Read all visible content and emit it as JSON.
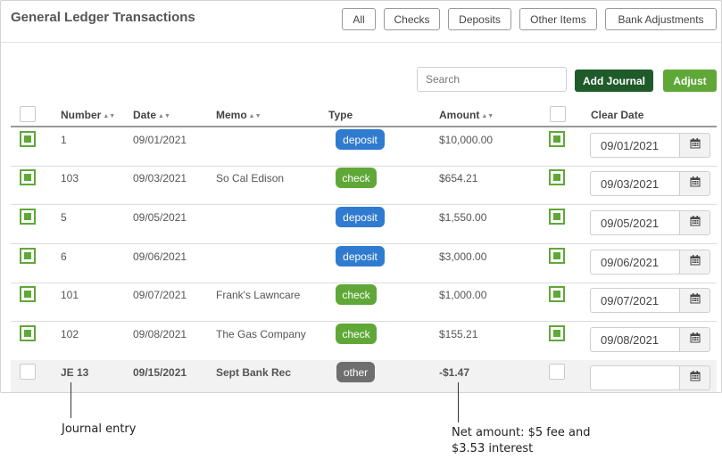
{
  "header": {
    "title": "General Ledger Transactions",
    "filters": [
      "All",
      "Checks",
      "Deposits",
      "Other Items",
      "Bank Adjustments"
    ]
  },
  "toolbar": {
    "search_placeholder": "Search",
    "add_journal_label": "Add Journal",
    "adjust_label": "Adjust"
  },
  "table": {
    "headers": {
      "number": "Number",
      "date": "Date",
      "memo": "Memo",
      "type": "Type",
      "amount": "Amount",
      "clear_date": "Clear Date"
    },
    "rows": [
      {
        "number": "1",
        "date": "09/01/2021",
        "memo": "",
        "type": "deposit",
        "amount": "$10,000.00",
        "clear_date": "09/01/2021",
        "selected": true,
        "cleared": true
      },
      {
        "number": "103",
        "date": "09/03/2021",
        "memo": "So Cal Edison",
        "type": "check",
        "amount": "$654.21",
        "clear_date": "09/03/2021",
        "selected": true,
        "cleared": true
      },
      {
        "number": "5",
        "date": "09/05/2021",
        "memo": "",
        "type": "deposit",
        "amount": "$1,550.00",
        "clear_date": "09/05/2021",
        "selected": true,
        "cleared": true
      },
      {
        "number": "6",
        "date": "09/06/2021",
        "memo": "",
        "type": "deposit",
        "amount": "$3,000.00",
        "clear_date": "09/06/2021",
        "selected": true,
        "cleared": true
      },
      {
        "number": "101",
        "date": "09/07/2021",
        "memo": "Frank's Lawncare",
        "type": "check",
        "amount": "$1,000.00",
        "clear_date": "09/07/2021",
        "selected": true,
        "cleared": true
      },
      {
        "number": "102",
        "date": "09/08/2021",
        "memo": "The Gas Company",
        "type": "check",
        "amount": "$155.21",
        "clear_date": "09/08/2021",
        "selected": true,
        "cleared": true
      },
      {
        "number": "JE 13",
        "date": "09/15/2021",
        "memo": "Sept Bank Rec",
        "type": "other",
        "amount": "-$1.47",
        "clear_date": "",
        "selected": false,
        "cleared": false
      }
    ]
  },
  "annotations": {
    "journal_entry": "Journal entry",
    "net_amount_line1": "Net amount: $5 fee and",
    "net_amount_line2": "$3.53 interest"
  },
  "colors": {
    "deposit": "#2f7bd0",
    "check": "#5fa838",
    "other": "#6e6e6e",
    "add_journal": "#1e5a2a",
    "adjust": "#5fa838"
  },
  "icons": {
    "calendar": "calendar-icon",
    "sort": "sort-icon"
  }
}
